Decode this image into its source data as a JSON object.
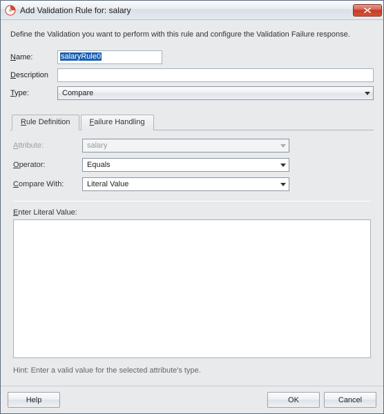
{
  "window": {
    "title": "Add Validation Rule for: salary"
  },
  "instruction": "Define the Validation you want to perform with this rule and configure the Validation Failure response.",
  "fields": {
    "name_label": "Name:",
    "name_value": "salaryRule0",
    "description_label": "Description",
    "description_value": "",
    "type_label": "Type:",
    "type_value": "Compare"
  },
  "tabs": {
    "rule_definition": "Rule Definition",
    "failure_handling": "Failure Handling"
  },
  "rule_def": {
    "attribute_label": "Attribute:",
    "attribute_value": "salary",
    "operator_label": "Operator:",
    "operator_value": "Equals",
    "compare_with_label": "Compare With:",
    "compare_with_value": "Literal Value",
    "enter_literal_label": "Enter Literal Value:",
    "literal_value": "",
    "hint": "Hint: Enter a valid value for the selected attribute's type."
  },
  "buttons": {
    "help": "Help",
    "ok": "OK",
    "cancel": "Cancel"
  }
}
